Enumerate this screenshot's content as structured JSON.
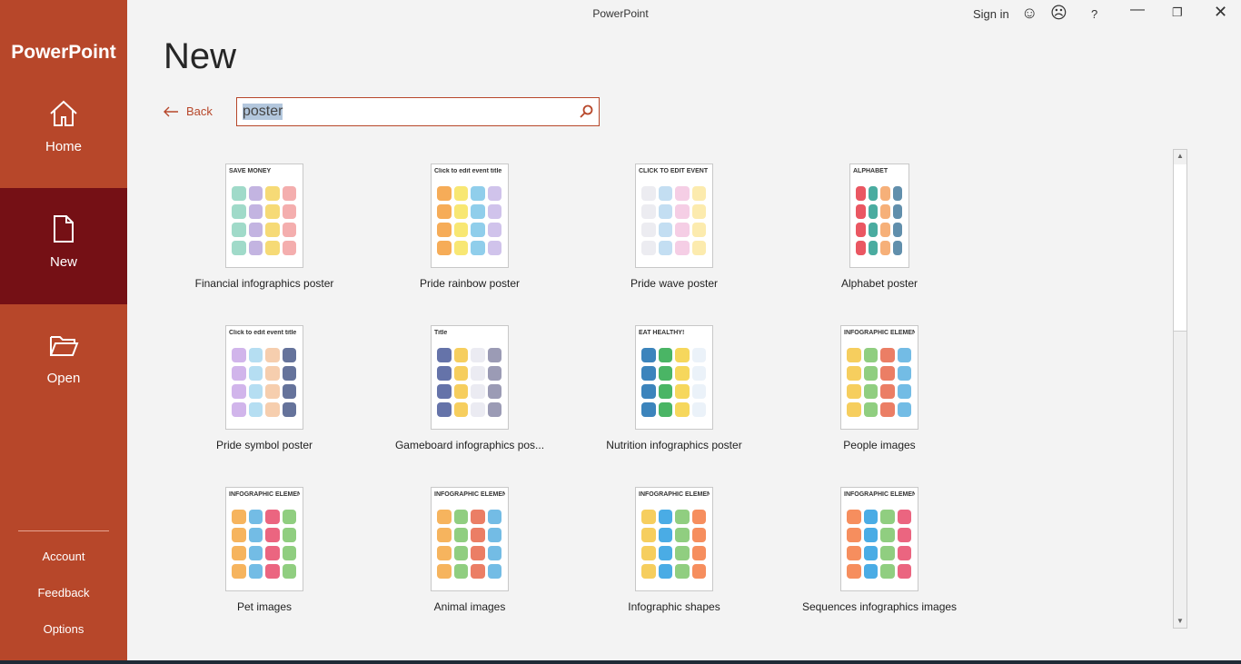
{
  "window": {
    "title": "PowerPoint",
    "sign_in": "Sign in"
  },
  "sidebar": {
    "brand": "PowerPoint",
    "items": [
      {
        "label": "Home",
        "icon": "home-icon"
      },
      {
        "label": "New",
        "icon": "new-file-icon"
      },
      {
        "label": "Open",
        "icon": "folder-open-icon"
      }
    ],
    "footer": [
      "Account",
      "Feedback",
      "Options"
    ]
  },
  "main": {
    "title": "New",
    "back_label": "Back",
    "search_value": "poster",
    "templates": [
      {
        "name": "Financial infographics poster",
        "colors": [
          "#8fd3c0",
          "#b8a7dc",
          "#f4d35e",
          "#f2a0a0"
        ],
        "thumb_text": "SAVE MONEY"
      },
      {
        "name": "Pride rainbow poster",
        "colors": [
          "#f59e3b",
          "#f7e35a",
          "#7cc6e8",
          "#c8b8e8"
        ],
        "thumb_text": "Click to edit event title"
      },
      {
        "name": "Pride wave poster",
        "colors": [
          "#e9e9ef",
          "#b8d8f0",
          "#f3c6e0",
          "#fbe7a0"
        ],
        "thumb_text": "CLICK TO EDIT EVENT TITLE"
      },
      {
        "name": "Alphabet poster",
        "colors": [
          "#e63946",
          "#2a9d8f",
          "#f4a261",
          "#457b9d"
        ],
        "thumb_text": "ALPHABET"
      },
      {
        "name": "Pride symbol poster",
        "colors": [
          "#c9a8e8",
          "#a8d8f0",
          "#f5c6a0",
          "#4a5a8a"
        ],
        "thumb_text": "Click to edit event title"
      },
      {
        "name": "Gameboard infographics pos...",
        "colors": [
          "#4a5a9a",
          "#f4c542",
          "#e8e8f0",
          "#8a8aa8"
        ],
        "thumb_text": "Title"
      },
      {
        "name": "Nutrition infographics poster",
        "colors": [
          "#1a6fb0",
          "#2aa84a",
          "#f4d03f",
          "#e8f0f8"
        ],
        "thumb_text": "EAT HEALTHY!"
      },
      {
        "name": "People images",
        "colors": [
          "#f4c542",
          "#7cc66a",
          "#e8674a",
          "#5ab0e0"
        ],
        "thumb_text": "INFOGRAPHIC ELEMENTS"
      },
      {
        "name": "Pet images",
        "colors": [
          "#f4a742",
          "#5ab0e0",
          "#e84a6a",
          "#7cc66a"
        ],
        "thumb_text": "INFOGRAPHIC ELEMENTS"
      },
      {
        "name": "Animal images",
        "colors": [
          "#f4a742",
          "#7cc66a",
          "#e8674a",
          "#5ab0e0"
        ],
        "thumb_text": "INFOGRAPHIC ELEMENTS"
      },
      {
        "name": "Infographic shapes",
        "colors": [
          "#f4c542",
          "#2a9de0",
          "#7cc66a",
          "#f47a42"
        ],
        "thumb_text": "INFOGRAPHIC ELEMENTS"
      },
      {
        "name": "Sequences infographics images",
        "colors": [
          "#f47a42",
          "#2a9de0",
          "#7cc66a",
          "#e84a6a"
        ],
        "thumb_text": "INFOGRAPHIC ELEMENTS"
      }
    ]
  },
  "colors": {
    "accent": "#b7472a",
    "active": "#751015"
  }
}
